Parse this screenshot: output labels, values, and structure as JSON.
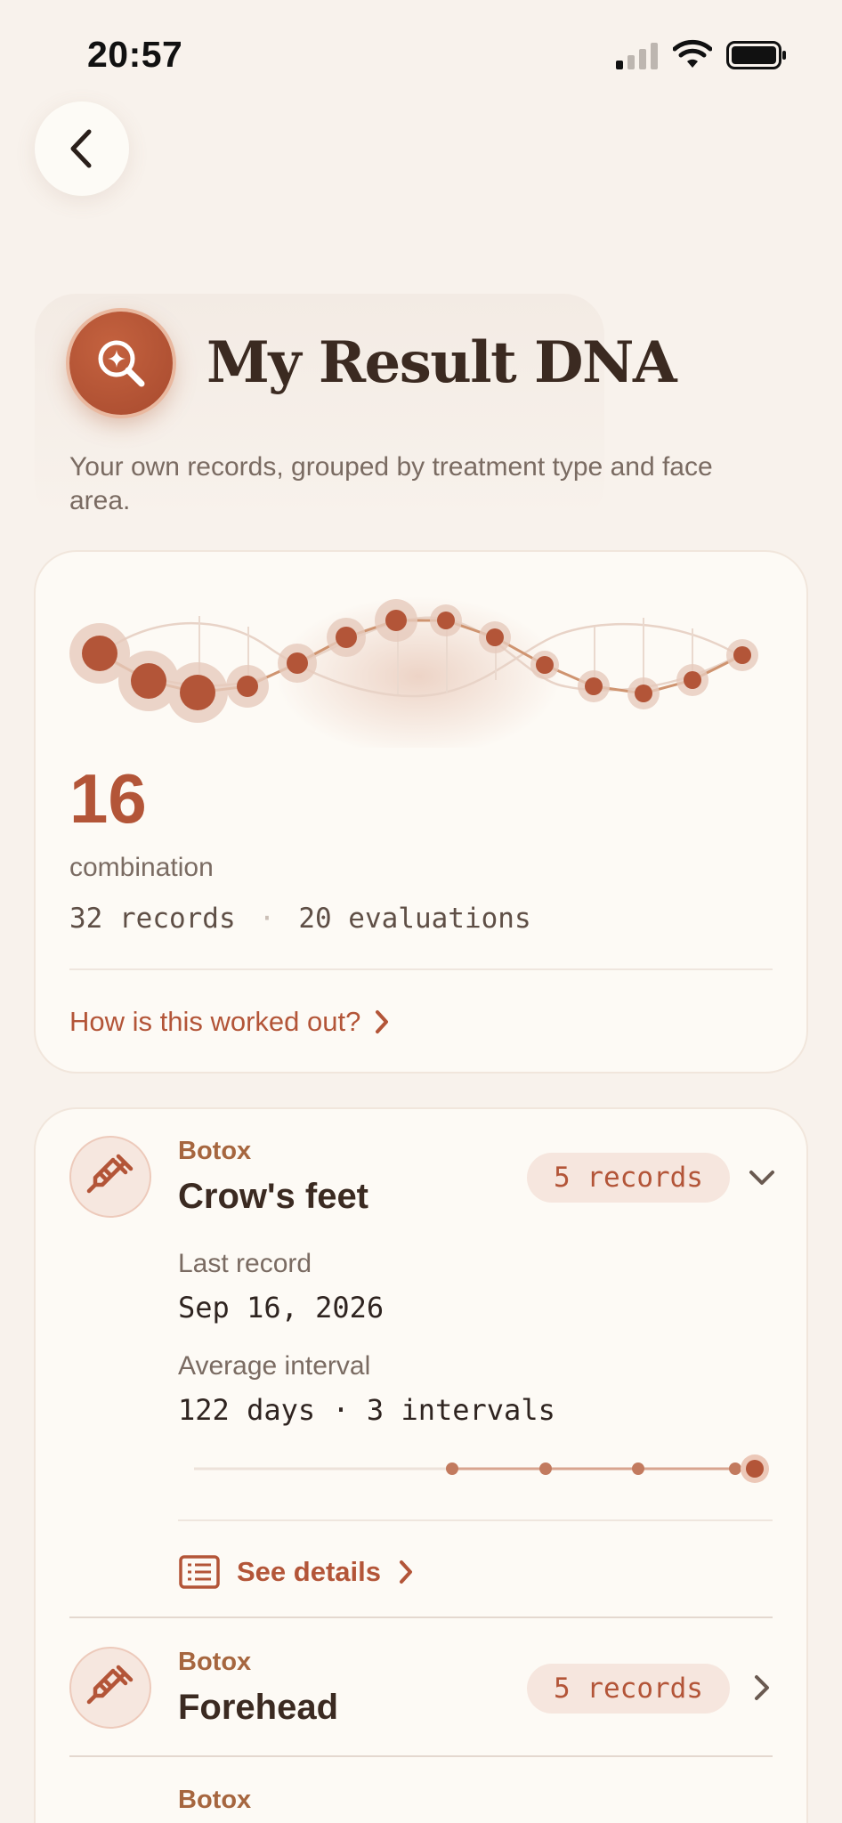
{
  "status_bar": {
    "time": "20:57"
  },
  "header": {
    "title": "My Result DNA",
    "subtitle": "Your own records, grouped by treatment type and face area."
  },
  "summary": {
    "count": "16",
    "label": "combination",
    "records": "32 records",
    "separator": "·",
    "evaluations": "20 evaluations",
    "link": "How is this worked out?"
  },
  "groups": [
    {
      "category": "Botox",
      "area": "Crow's feet",
      "records": "5 records",
      "expanded": true,
      "last_record_label": "Last record",
      "last_record_value": "Sep 16, 2026",
      "avg_interval_label": "Average interval",
      "avg_interval_value": "122 days · 3 intervals",
      "details_link": "See details"
    },
    {
      "category": "Botox",
      "area": "Forehead",
      "records": "5 records",
      "expanded": false
    },
    {
      "category": "Botox"
    }
  ],
  "colors": {
    "accent": "#b35538",
    "background": "#f8f2ec",
    "card": "#fdfaf5",
    "category": "#a6663f"
  }
}
